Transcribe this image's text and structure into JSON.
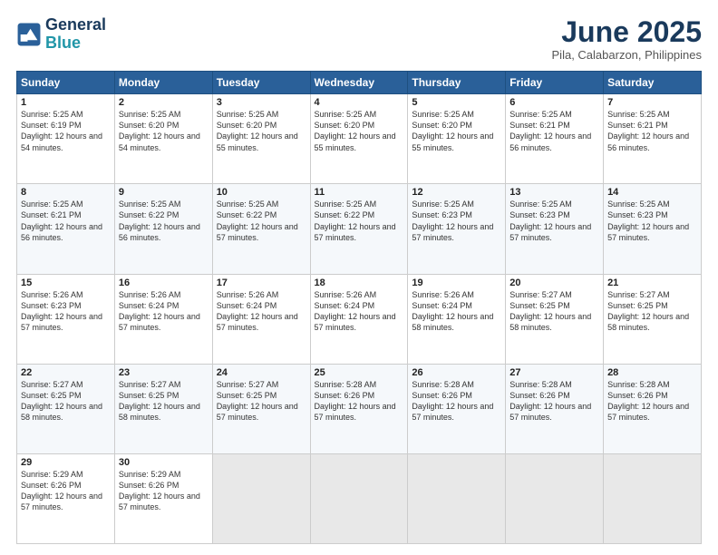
{
  "header": {
    "logo_line1": "General",
    "logo_line2": "Blue",
    "month_title": "June 2025",
    "location": "Pila, Calabarzon, Philippines"
  },
  "days_of_week": [
    "Sunday",
    "Monday",
    "Tuesday",
    "Wednesday",
    "Thursday",
    "Friday",
    "Saturday"
  ],
  "weeks": [
    [
      {
        "day": "1",
        "sunrise": "5:25 AM",
        "sunset": "6:19 PM",
        "daylight": "12 hours and 54 minutes."
      },
      {
        "day": "2",
        "sunrise": "5:25 AM",
        "sunset": "6:20 PM",
        "daylight": "12 hours and 54 minutes."
      },
      {
        "day": "3",
        "sunrise": "5:25 AM",
        "sunset": "6:20 PM",
        "daylight": "12 hours and 55 minutes."
      },
      {
        "day": "4",
        "sunrise": "5:25 AM",
        "sunset": "6:20 PM",
        "daylight": "12 hours and 55 minutes."
      },
      {
        "day": "5",
        "sunrise": "5:25 AM",
        "sunset": "6:20 PM",
        "daylight": "12 hours and 55 minutes."
      },
      {
        "day": "6",
        "sunrise": "5:25 AM",
        "sunset": "6:21 PM",
        "daylight": "12 hours and 56 minutes."
      },
      {
        "day": "7",
        "sunrise": "5:25 AM",
        "sunset": "6:21 PM",
        "daylight": "12 hours and 56 minutes."
      }
    ],
    [
      {
        "day": "8",
        "sunrise": "5:25 AM",
        "sunset": "6:21 PM",
        "daylight": "12 hours and 56 minutes."
      },
      {
        "day": "9",
        "sunrise": "5:25 AM",
        "sunset": "6:22 PM",
        "daylight": "12 hours and 56 minutes."
      },
      {
        "day": "10",
        "sunrise": "5:25 AM",
        "sunset": "6:22 PM",
        "daylight": "12 hours and 57 minutes."
      },
      {
        "day": "11",
        "sunrise": "5:25 AM",
        "sunset": "6:22 PM",
        "daylight": "12 hours and 57 minutes."
      },
      {
        "day": "12",
        "sunrise": "5:25 AM",
        "sunset": "6:23 PM",
        "daylight": "12 hours and 57 minutes."
      },
      {
        "day": "13",
        "sunrise": "5:25 AM",
        "sunset": "6:23 PM",
        "daylight": "12 hours and 57 minutes."
      },
      {
        "day": "14",
        "sunrise": "5:25 AM",
        "sunset": "6:23 PM",
        "daylight": "12 hours and 57 minutes."
      }
    ],
    [
      {
        "day": "15",
        "sunrise": "5:26 AM",
        "sunset": "6:23 PM",
        "daylight": "12 hours and 57 minutes."
      },
      {
        "day": "16",
        "sunrise": "5:26 AM",
        "sunset": "6:24 PM",
        "daylight": "12 hours and 57 minutes."
      },
      {
        "day": "17",
        "sunrise": "5:26 AM",
        "sunset": "6:24 PM",
        "daylight": "12 hours and 57 minutes."
      },
      {
        "day": "18",
        "sunrise": "5:26 AM",
        "sunset": "6:24 PM",
        "daylight": "12 hours and 57 minutes."
      },
      {
        "day": "19",
        "sunrise": "5:26 AM",
        "sunset": "6:24 PM",
        "daylight": "12 hours and 58 minutes."
      },
      {
        "day": "20",
        "sunrise": "5:27 AM",
        "sunset": "6:25 PM",
        "daylight": "12 hours and 58 minutes."
      },
      {
        "day": "21",
        "sunrise": "5:27 AM",
        "sunset": "6:25 PM",
        "daylight": "12 hours and 58 minutes."
      }
    ],
    [
      {
        "day": "22",
        "sunrise": "5:27 AM",
        "sunset": "6:25 PM",
        "daylight": "12 hours and 58 minutes."
      },
      {
        "day": "23",
        "sunrise": "5:27 AM",
        "sunset": "6:25 PM",
        "daylight": "12 hours and 58 minutes."
      },
      {
        "day": "24",
        "sunrise": "5:27 AM",
        "sunset": "6:25 PM",
        "daylight": "12 hours and 57 minutes."
      },
      {
        "day": "25",
        "sunrise": "5:28 AM",
        "sunset": "6:26 PM",
        "daylight": "12 hours and 57 minutes."
      },
      {
        "day": "26",
        "sunrise": "5:28 AM",
        "sunset": "6:26 PM",
        "daylight": "12 hours and 57 minutes."
      },
      {
        "day": "27",
        "sunrise": "5:28 AM",
        "sunset": "6:26 PM",
        "daylight": "12 hours and 57 minutes."
      },
      {
        "day": "28",
        "sunrise": "5:28 AM",
        "sunset": "6:26 PM",
        "daylight": "12 hours and 57 minutes."
      }
    ],
    [
      {
        "day": "29",
        "sunrise": "5:29 AM",
        "sunset": "6:26 PM",
        "daylight": "12 hours and 57 minutes."
      },
      {
        "day": "30",
        "sunrise": "5:29 AM",
        "sunset": "6:26 PM",
        "daylight": "12 hours and 57 minutes."
      },
      null,
      null,
      null,
      null,
      null
    ]
  ],
  "labels": {
    "sunrise": "Sunrise:",
    "sunset": "Sunset:",
    "daylight": "Daylight:"
  }
}
